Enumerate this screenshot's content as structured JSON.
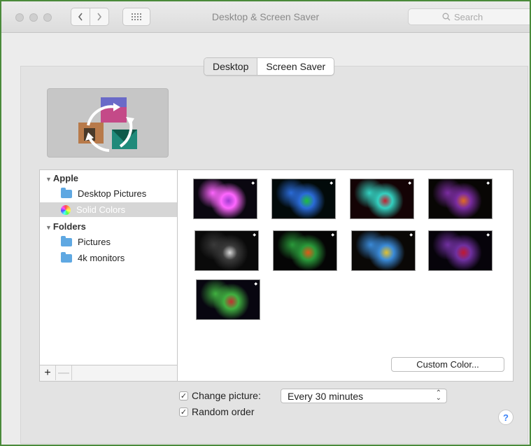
{
  "window": {
    "title": "Desktop & Screen Saver",
    "search_placeholder": "Search",
    "grid_icon": "grid-icon",
    "back_icon": "chevron-left-icon",
    "forward_icon": "chevron-right-icon"
  },
  "tabs": [
    {
      "label": "Desktop",
      "selected": true
    },
    {
      "label": "Screen Saver",
      "selected": false
    }
  ],
  "sidebar": {
    "groups": [
      {
        "label": "Apple",
        "items": [
          {
            "label": "Desktop Pictures",
            "icon": "folder-icon",
            "selected": false
          },
          {
            "label": "Solid Colors",
            "icon": "color-wheel-icon",
            "selected": true
          }
        ]
      },
      {
        "label": "Folders",
        "items": [
          {
            "label": "Pictures",
            "icon": "folder-icon",
            "selected": false
          },
          {
            "label": "4k monitors",
            "icon": "folder-icon",
            "selected": false
          }
        ]
      }
    ],
    "add_label": "+",
    "remove_label": "—"
  },
  "thumbnails": [
    {
      "name": "neuron-purple",
      "colors": [
        "#0a0710",
        "#a13cd0",
        "#ff66ff"
      ]
    },
    {
      "name": "green-cell",
      "colors": [
        "#020a0a",
        "#1fbf3a",
        "#2a6bd8"
      ]
    },
    {
      "name": "red-dots",
      "colors": [
        "#140305",
        "#c02030",
        "#33d0c0"
      ]
    },
    {
      "name": "orange-brain",
      "colors": [
        "#080604",
        "#e06a20",
        "#7a2ca0"
      ]
    },
    {
      "name": "white-dots",
      "colors": [
        "#0a0a0a",
        "#d8d8d8",
        "#3a3a3a"
      ]
    },
    {
      "name": "orange-tissue",
      "colors": [
        "#050505",
        "#e05a18",
        "#2a9a3a"
      ]
    },
    {
      "name": "yellow-neuron",
      "colors": [
        "#0a0806",
        "#e0c030",
        "#3a8ad8"
      ]
    },
    {
      "name": "red-wave",
      "colors": [
        "#06030a",
        "#c01830",
        "#7030a0"
      ]
    },
    {
      "name": "tissue-multicolor",
      "colors": [
        "#080610",
        "#c03030",
        "#40b040"
      ]
    }
  ],
  "custom_color_label": "Custom Color...",
  "change_picture": {
    "label": "Change picture:",
    "checked": true,
    "interval": "Every 30 minutes"
  },
  "random_order": {
    "label": "Random order",
    "checked": true
  },
  "help_label": "?",
  "colors": {
    "frame": "#4a8a3a",
    "folder": "#5fa8e2",
    "help": "#3a82f7"
  }
}
